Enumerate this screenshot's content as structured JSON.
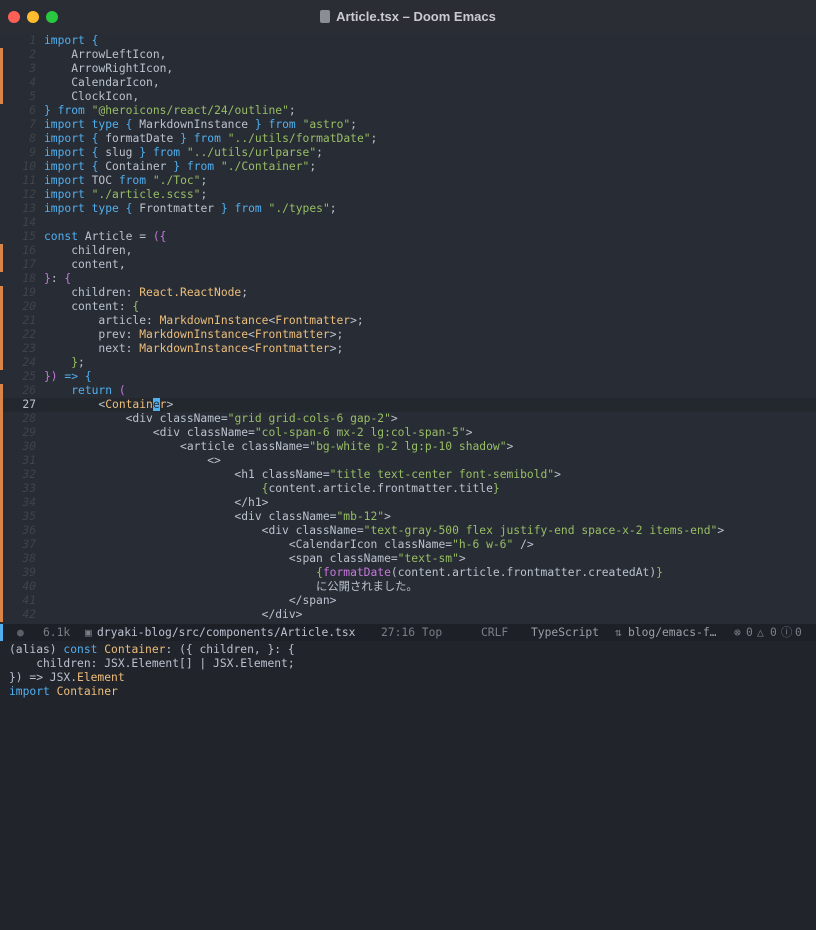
{
  "window": {
    "title": "Article.tsx – Doom Emacs",
    "file_icon": "file-icon",
    "traffic_lights": {
      "close": "#fe5f57",
      "minimize": "#febc2e",
      "zoom": "#28c840"
    }
  },
  "colors": {
    "background": "#282c34",
    "keyword": "#51afef",
    "string": "#98be65",
    "type": "#ECBE7B",
    "purple": "#c678dd",
    "modified_gutter": "#da8548"
  },
  "editor": {
    "current_line": 27,
    "modified_lines": [
      2,
      3,
      4,
      5,
      16,
      17,
      19,
      20,
      21,
      22,
      23,
      24,
      26,
      27,
      28,
      29,
      30,
      31,
      32,
      33,
      34,
      35,
      36,
      37,
      38,
      39,
      40,
      41,
      42
    ],
    "lines": [
      [
        [
          "k",
          "import"
        ],
        [
          "d",
          " "
        ],
        [
          "b",
          "{"
        ]
      ],
      [
        [
          "d",
          "    ArrowLeftIcon,"
        ]
      ],
      [
        [
          "d",
          "    ArrowRightIcon,"
        ]
      ],
      [
        [
          "d",
          "    CalendarIcon,"
        ]
      ],
      [
        [
          "d",
          "    ClockIcon,"
        ]
      ],
      [
        [
          "b",
          "}"
        ],
        [
          "d",
          " "
        ],
        [
          "k",
          "from"
        ],
        [
          "d",
          " "
        ],
        [
          "s",
          "\"@heroicons/react/24/outline\""
        ],
        [
          "d",
          ";"
        ]
      ],
      [
        [
          "k",
          "import"
        ],
        [
          "d",
          " "
        ],
        [
          "k",
          "type"
        ],
        [
          "d",
          " "
        ],
        [
          "b",
          "{"
        ],
        [
          "d",
          " MarkdownInstance "
        ],
        [
          "b",
          "}"
        ],
        [
          "d",
          " "
        ],
        [
          "k",
          "from"
        ],
        [
          "d",
          " "
        ],
        [
          "s",
          "\"astro\""
        ],
        [
          "d",
          ";"
        ]
      ],
      [
        [
          "k",
          "import"
        ],
        [
          "d",
          " "
        ],
        [
          "b",
          "{"
        ],
        [
          "d",
          " formatDate "
        ],
        [
          "b",
          "}"
        ],
        [
          "d",
          " "
        ],
        [
          "k",
          "from"
        ],
        [
          "d",
          " "
        ],
        [
          "s",
          "\"../utils/formatDate\""
        ],
        [
          "d",
          ";"
        ]
      ],
      [
        [
          "k",
          "import"
        ],
        [
          "d",
          " "
        ],
        [
          "b",
          "{"
        ],
        [
          "d",
          " slug "
        ],
        [
          "b",
          "}"
        ],
        [
          "d",
          " "
        ],
        [
          "k",
          "from"
        ],
        [
          "d",
          " "
        ],
        [
          "s",
          "\"../utils/urlparse\""
        ],
        [
          "d",
          ";"
        ]
      ],
      [
        [
          "k",
          "import"
        ],
        [
          "d",
          " "
        ],
        [
          "b",
          "{"
        ],
        [
          "d",
          " Container "
        ],
        [
          "b",
          "}"
        ],
        [
          "d",
          " "
        ],
        [
          "k",
          "from"
        ],
        [
          "d",
          " "
        ],
        [
          "s",
          "\"./Container\""
        ],
        [
          "d",
          ";"
        ]
      ],
      [
        [
          "k",
          "import"
        ],
        [
          "d",
          " TOC "
        ],
        [
          "k",
          "from"
        ],
        [
          "d",
          " "
        ],
        [
          "s",
          "\"./Toc\""
        ],
        [
          "d",
          ";"
        ]
      ],
      [
        [
          "k",
          "import"
        ],
        [
          "d",
          " "
        ],
        [
          "s",
          "\"./article.scss\""
        ],
        [
          "d",
          ";"
        ]
      ],
      [
        [
          "k",
          "import"
        ],
        [
          "d",
          " "
        ],
        [
          "k",
          "type"
        ],
        [
          "d",
          " "
        ],
        [
          "b",
          "{"
        ],
        [
          "d",
          " Frontmatter "
        ],
        [
          "b",
          "}"
        ],
        [
          "d",
          " "
        ],
        [
          "k",
          "from"
        ],
        [
          "d",
          " "
        ],
        [
          "s",
          "\"./types\""
        ],
        [
          "d",
          ";"
        ]
      ],
      [],
      [
        [
          "k",
          "const"
        ],
        [
          "d",
          " Article = "
        ],
        [
          "p",
          "({"
        ]
      ],
      [
        [
          "d",
          "    children,"
        ]
      ],
      [
        [
          "d",
          "    content,"
        ]
      ],
      [
        [
          "p",
          "}"
        ],
        [
          "d",
          ": "
        ],
        [
          "p",
          "{"
        ]
      ],
      [
        [
          "d",
          "    children: "
        ],
        [
          "t",
          "React.ReactNode"
        ],
        [
          "d",
          ";"
        ]
      ],
      [
        [
          "d",
          "    content: "
        ],
        [
          "g",
          "{"
        ]
      ],
      [
        [
          "d",
          "        article: "
        ],
        [
          "t",
          "MarkdownInstance"
        ],
        [
          "d",
          "<"
        ],
        [
          "t",
          "Frontmatter"
        ],
        [
          "d",
          ">;"
        ]
      ],
      [
        [
          "d",
          "        prev: "
        ],
        [
          "t",
          "MarkdownInstance"
        ],
        [
          "d",
          "<"
        ],
        [
          "t",
          "Frontmatter"
        ],
        [
          "d",
          ">;"
        ]
      ],
      [
        [
          "d",
          "        next: "
        ],
        [
          "t",
          "MarkdownInstance"
        ],
        [
          "d",
          "<"
        ],
        [
          "t",
          "Frontmatter"
        ],
        [
          "d",
          ">;"
        ]
      ],
      [
        [
          "d",
          "    "
        ],
        [
          "g",
          "}"
        ],
        [
          "d",
          ";"
        ]
      ],
      [
        [
          "p",
          "})"
        ],
        [
          "d",
          " "
        ],
        [
          "k",
          "=>"
        ],
        [
          "d",
          " "
        ],
        [
          "b",
          "{"
        ]
      ],
      [
        [
          "d",
          "    "
        ],
        [
          "k",
          "return"
        ],
        [
          "d",
          " "
        ],
        [
          "p",
          "("
        ]
      ],
      [
        [
          "d",
          "        <"
        ],
        [
          "t",
          "Contain"
        ],
        [
          "c",
          "e"
        ],
        [
          "t",
          "r"
        ],
        [
          "d",
          ">"
        ]
      ],
      [
        [
          "d",
          "            <div className="
        ],
        [
          "s",
          "\"grid grid-cols-6 gap-2\""
        ],
        [
          "d",
          ">"
        ]
      ],
      [
        [
          "d",
          "                <div className="
        ],
        [
          "s",
          "\"col-span-6 mx-2 lg:col-span-5\""
        ],
        [
          "d",
          ">"
        ]
      ],
      [
        [
          "d",
          "                    <article className="
        ],
        [
          "s",
          "\"bg-white p-2 lg:p-10 shadow\""
        ],
        [
          "d",
          ">"
        ]
      ],
      [
        [
          "d",
          "                        <>"
        ]
      ],
      [
        [
          "d",
          "                            <h1 className="
        ],
        [
          "s",
          "\"title text-center font-semibold\""
        ],
        [
          "d",
          ">"
        ]
      ],
      [
        [
          "d",
          "                                "
        ],
        [
          "g",
          "{"
        ],
        [
          "d",
          "content.article.frontmatter.title"
        ],
        [
          "g",
          "}"
        ]
      ],
      [
        [
          "d",
          "                            </h1>"
        ]
      ],
      [
        [
          "d",
          "                            <div className="
        ],
        [
          "s",
          "\"mb-12\""
        ],
        [
          "d",
          ">"
        ]
      ],
      [
        [
          "d",
          "                                <div className="
        ],
        [
          "s",
          "\"text-gray-500 flex justify-end space-x-2 items-end\""
        ],
        [
          "d",
          ">"
        ]
      ],
      [
        [
          "d",
          "                                    <CalendarIcon className="
        ],
        [
          "s",
          "\"h-6 w-6\""
        ],
        [
          "d",
          " />"
        ]
      ],
      [
        [
          "d",
          "                                    <span className="
        ],
        [
          "s",
          "\"text-sm\""
        ],
        [
          "d",
          ">"
        ]
      ],
      [
        [
          "d",
          "                                        "
        ],
        [
          "g",
          "{"
        ],
        [
          "p",
          "formatDate"
        ],
        [
          "d",
          "(content.article.frontmatter.createdAt)"
        ],
        [
          "g",
          "}"
        ]
      ],
      [
        [
          "d",
          "                                        に公開されました。"
        ]
      ],
      [
        [
          "d",
          "                                    </span>"
        ]
      ],
      [
        [
          "d",
          "                                </div>"
        ]
      ]
    ]
  },
  "modeline": {
    "size": "6.1k",
    "file": "dryaki-blog/src/components/Article.tsx",
    "position": "27:16 Top",
    "eol": "CRLF",
    "mode": "TypeScript",
    "branch": "blog/emacs-f…",
    "errors": "0",
    "warnings": "0",
    "info": "0"
  },
  "echo": {
    "lines": [
      [
        [
          "d",
          "(alias) "
        ],
        [
          "k",
          "const"
        ],
        [
          "d",
          " "
        ],
        [
          "t",
          "Container"
        ],
        [
          "d",
          ": ({ children, }: {"
        ]
      ],
      [
        [
          "d",
          "    children: JSX.Element[] | JSX.Element;"
        ]
      ],
      [
        [
          "d",
          "}) => JSX."
        ],
        [
          "t",
          "Element"
        ]
      ],
      [
        [
          "k",
          "import"
        ],
        [
          "d",
          " "
        ],
        [
          "t",
          "Container"
        ]
      ]
    ]
  }
}
